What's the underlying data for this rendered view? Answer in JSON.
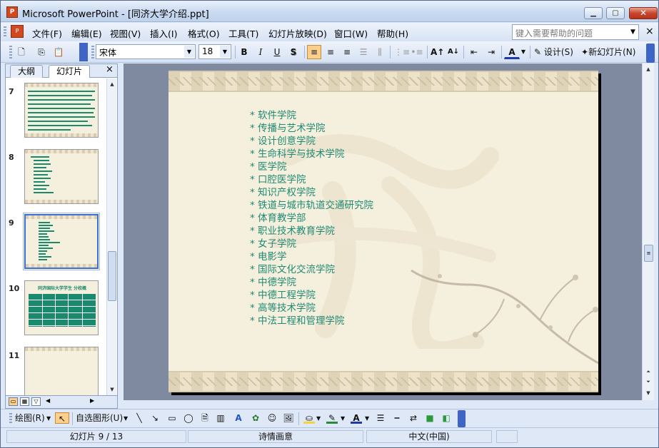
{
  "window": {
    "title": "Microsoft PowerPoint - [同济大学介绍.ppt]"
  },
  "menu": {
    "items": [
      "文件(F)",
      "编辑(E)",
      "视图(V)",
      "插入(I)",
      "格式(O)",
      "工具(T)",
      "幻灯片放映(D)",
      "窗口(W)",
      "帮助(H)"
    ],
    "help_placeholder": "键入需要帮助的问题"
  },
  "toolbar": {
    "font_name": "宋体",
    "font_size": "18",
    "bold": "B",
    "italic": "I",
    "underline": "U",
    "shadow": "S",
    "design_label": "设计(S)",
    "new_slide_label": "新幻灯片(N)"
  },
  "left_pane": {
    "tabs": [
      "大纲",
      "幻灯片"
    ],
    "close": "×",
    "thumb_numbers": [
      "7",
      "8",
      "9",
      "10",
      "11"
    ],
    "thumb10_title": "同济国际大学学生 分校概"
  },
  "slide": {
    "bullets": [
      "* 软件学院",
      " * 传播与艺术学院",
      " * 设计创意学院",
      " * 生命科学与技术学院",
      " * 医学院",
      " * 口腔医学院",
      " * 知识产权学院",
      " * 铁道与城市轨道交通研究院",
      " * 体育教学部",
      " * 职业技术教育学院",
      " * 女子学院",
      " * 电影学",
      " * 国际文化交流学院",
      " * 中德学院",
      " * 中德工程学院",
      " * 高等技术学院",
      " * 中法工程和管理学院"
    ]
  },
  "drawing_toolbar": {
    "draw_label": "绘图(R)",
    "autoshape_label": "自选图形(U)"
  },
  "status": {
    "slide_position": "幻灯片 9 / 13",
    "design_template": "诗情画意",
    "language": "中文(中国)"
  }
}
